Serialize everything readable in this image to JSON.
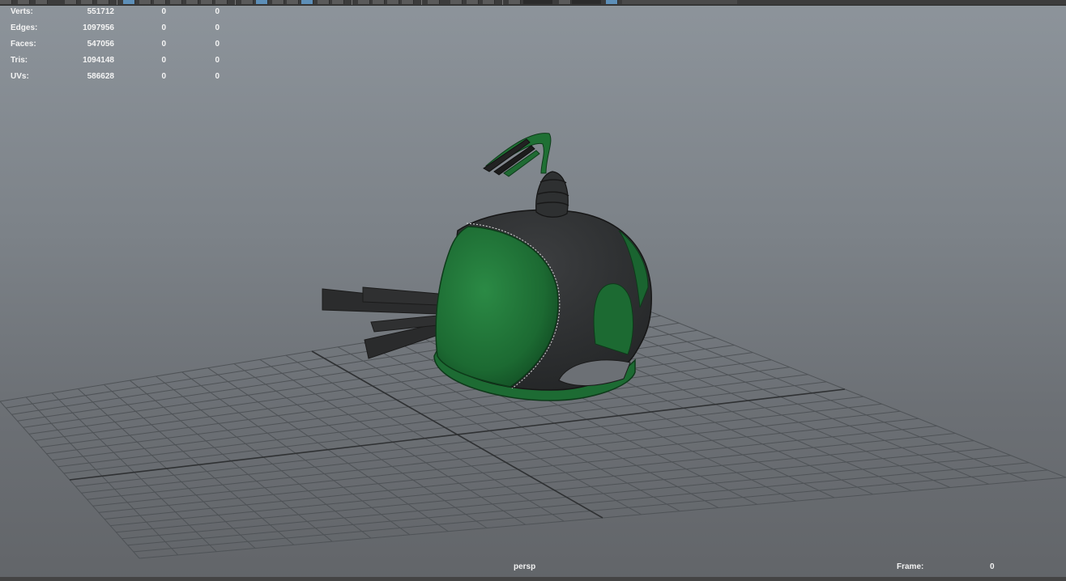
{
  "hud": {
    "rows": [
      {
        "label": "Verts:",
        "total": "551712",
        "selected": "0",
        "extra": "0"
      },
      {
        "label": "Edges:",
        "total": "1097956",
        "selected": "0",
        "extra": "0"
      },
      {
        "label": "Faces:",
        "total": "547056",
        "selected": "0",
        "extra": "0"
      },
      {
        "label": "Tris:",
        "total": "1094148",
        "selected": "0",
        "extra": "0"
      },
      {
        "label": "UVs:",
        "total": "586628",
        "selected": "0",
        "extra": "0"
      }
    ]
  },
  "viewport": {
    "camera": "persp",
    "frame_label": "Frame:",
    "frame_value": "0"
  },
  "colors": {
    "background_top": "#8d949b",
    "background_bottom": "#626569",
    "grid": "#4f5357",
    "grid_axis": "#2c2e30",
    "helmet_green": "#1f6e34",
    "helmet_black": "#2e3031"
  },
  "icons": [
    "viewport-toolbar-icons"
  ]
}
